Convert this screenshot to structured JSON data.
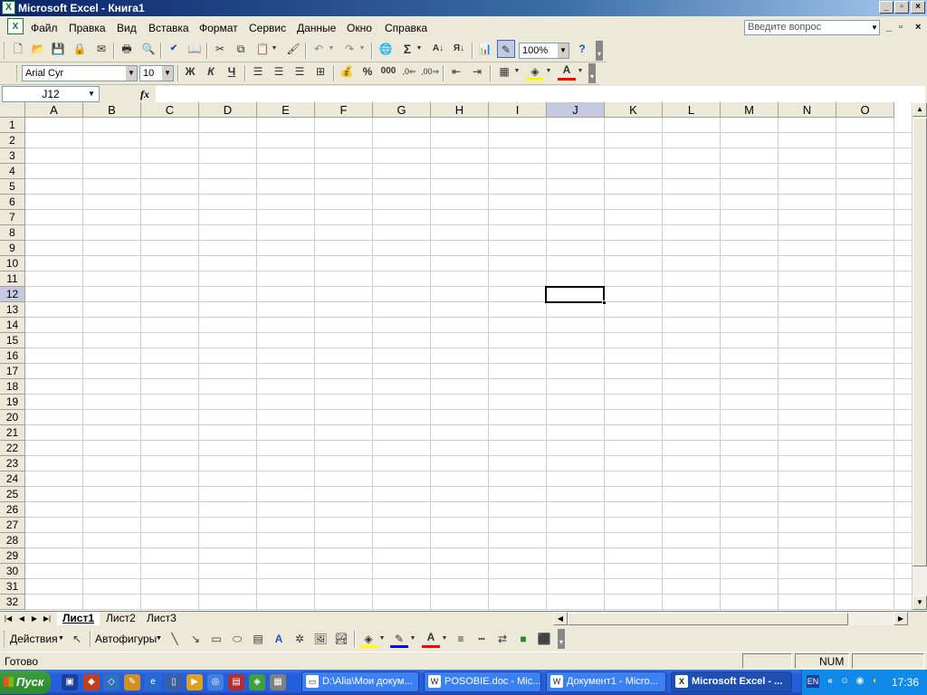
{
  "window": {
    "title": "Microsoft Excel - Книга1",
    "excel_icon_letter": "X",
    "caption_min": "_",
    "caption_max": "▫",
    "caption_close": "×"
  },
  "menu": {
    "items": [
      "Файл",
      "Правка",
      "Вид",
      "Вставка",
      "Формат",
      "Сервис",
      "Данные",
      "Окно",
      "Справка"
    ],
    "ask_placeholder": "Введите вопрос",
    "mdi_min": "_",
    "mdi_restore": "▫",
    "mdi_close": "×"
  },
  "standard_toolbar": {
    "zoom": "100%"
  },
  "formatting_toolbar": {
    "font": "Arial Cyr",
    "size": "10",
    "bold": "Ж",
    "italic": "К",
    "underline": "Ч",
    "percent": "%",
    "thousands": "000",
    "font_color_letter": "A"
  },
  "formula_bar": {
    "name_box": "J12",
    "fx": "fx",
    "value": ""
  },
  "grid": {
    "columns": [
      "A",
      "B",
      "C",
      "D",
      "E",
      "F",
      "G",
      "H",
      "I",
      "J",
      "K",
      "L",
      "M",
      "N",
      "O"
    ],
    "rows": [
      "1",
      "2",
      "3",
      "4",
      "5",
      "6",
      "7",
      "8",
      "9",
      "10",
      "11",
      "12",
      "13",
      "14",
      "15",
      "16",
      "17",
      "18",
      "19",
      "20",
      "21",
      "22",
      "23",
      "24",
      "25",
      "26",
      "27",
      "28",
      "29",
      "30",
      "31",
      "32"
    ],
    "selected_column": "J",
    "selected_row": "12"
  },
  "sheets": {
    "tabs": [
      "Лист1",
      "Лист2",
      "Лист3"
    ],
    "active": "Лист1"
  },
  "drawing_toolbar": {
    "actions": "Действия",
    "autoshapes": "Автофигуры"
  },
  "status": {
    "ready": "Готово",
    "num": "NUM"
  },
  "taskbar": {
    "start": "Пуск",
    "tasks": [
      "D:\\Alia\\Мои докум...",
      "POSOBIE.doc - Mic...",
      "Документ1 - Micro...",
      "Microsoft Excel - ..."
    ],
    "tray_lang": "EN",
    "tray_expand": "«",
    "clock": "17:36"
  },
  "colors": {
    "title_start": "#0a246a",
    "title_end": "#a6caf0",
    "selected_header": "#c4cbe0",
    "taskbar": "#245edb",
    "start_button": "#2d8a2d"
  }
}
